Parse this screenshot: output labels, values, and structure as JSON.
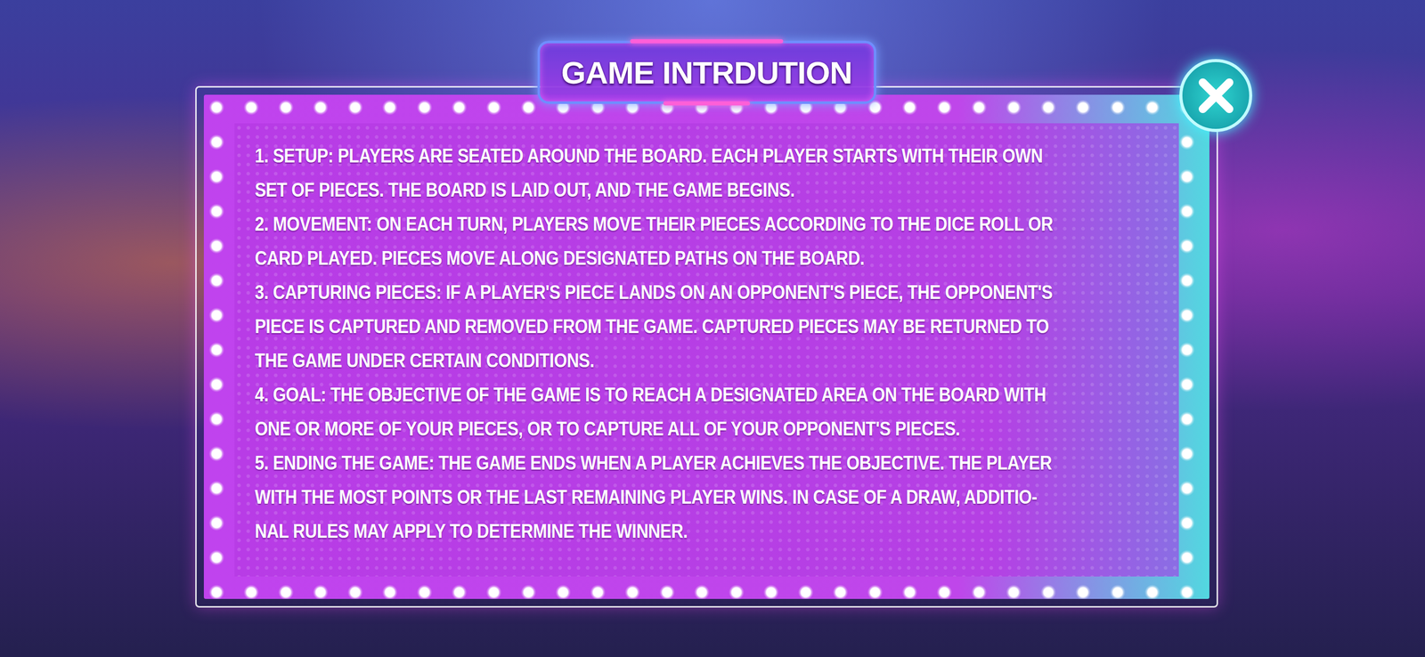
{
  "dialog": {
    "title": "GAME INTRDUTION",
    "rules": [
      {
        "lines": [
          "1. SETUP: PLAYERS ARE SEATED AROUND THE BOARD. EACH PLAYER STARTS WITH THEIR OWN",
          "SET OF PIECES. THE BOARD IS LAID OUT, AND THE GAME BEGINS."
        ]
      },
      {
        "lines": [
          "2. MOVEMENT: ON EACH TURN, PLAYERS MOVE THEIR PIECES ACCORDING TO THE DICE ROLL OR",
          "CARD PLAYED. PIECES MOVE ALONG DESIGNATED PATHS ON THE BOARD."
        ]
      },
      {
        "lines": [
          "3. CAPTURING PIECES: IF A PLAYER'S PIECE LANDS ON AN OPPONENT'S PIECE, THE OPPONENT'S",
          "PIECE IS CAPTURED AND REMOVED FROM THE GAME. CAPTURED PIECES MAY BE RETURNED TO",
          "THE GAME UNDER CERTAIN CONDITIONS."
        ]
      },
      {
        "lines": [
          "4. GOAL: THE OBJECTIVE OF THE GAME IS TO REACH A DESIGNATED AREA ON THE BOARD WITH",
          "ONE OR MORE OF YOUR PIECES, OR TO CAPTURE ALL OF YOUR OPPONENT'S PIECES."
        ]
      },
      {
        "lines": [
          "5. ENDING THE GAME: THE GAME ENDS WHEN A PLAYER ACHIEVES THE OBJECTIVE. THE PLAYER",
          "WITH THE MOST POINTS OR THE LAST REMAINING PLAYER WINS. IN CASE OF A DRAW, ADDITIO-",
          "NAL RULES MAY APPLY TO DETERMINE THE WINNER."
        ]
      }
    ]
  }
}
